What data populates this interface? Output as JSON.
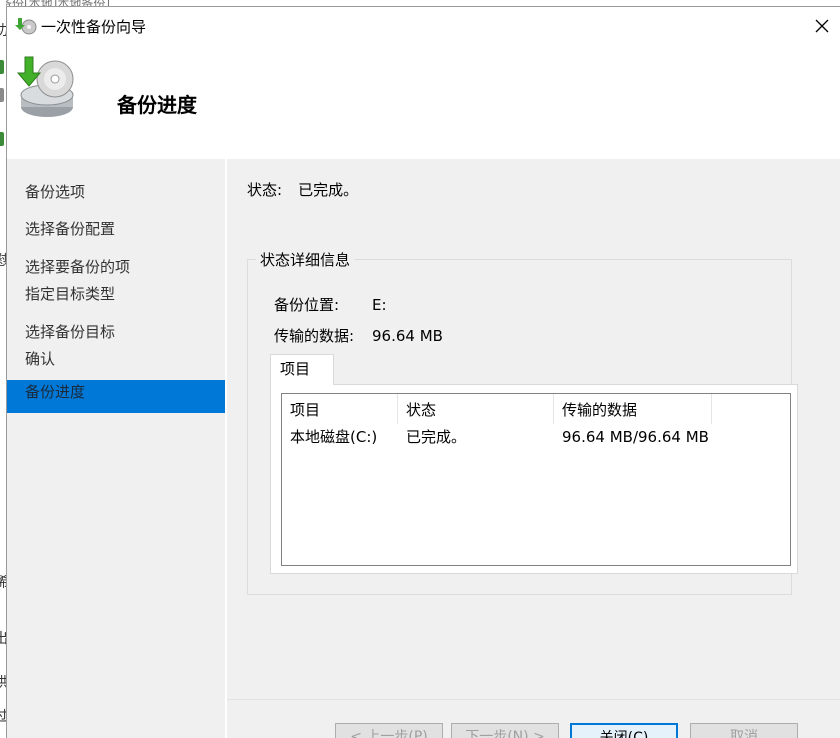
{
  "background": {
    "top_text": "备份[本地]本地备份]",
    "fragments": [
      "功",
      " ",
      "慰",
      "稀",
      "出",
      "烘",
      "过"
    ]
  },
  "dialog": {
    "title": "一次性备份向导",
    "header_title": "备份进度"
  },
  "nav": {
    "items": [
      {
        "label": "备份选项",
        "active": false
      },
      {
        "label": "选择备份配置",
        "active": false
      },
      {
        "label": "选择要备份的项",
        "active": false
      },
      {
        "label": "指定目标类型",
        "active": false
      },
      {
        "label": "选择备份目标",
        "active": false
      },
      {
        "label": "确认",
        "active": false
      },
      {
        "label": "备份进度",
        "active": true
      }
    ]
  },
  "status": {
    "label": "状态:",
    "value": "已完成。"
  },
  "details": {
    "group_title": "状态详细信息",
    "location_label": "备份位置:",
    "location_value": "E:",
    "transferred_label": "传输的数据:",
    "transferred_value": "96.64 MB",
    "tab_label": "项目",
    "columns": [
      "项目",
      "状态",
      "传输的数据"
    ],
    "rows": [
      {
        "item": "本地磁盘(C:)",
        "status": "已完成。",
        "transferred": "96.64 MB/96.64 MB"
      }
    ]
  },
  "buttons": {
    "prev": "< 上一步(P)",
    "next": "下一步(N) >",
    "close": "关闭(C)",
    "cancel": "取消"
  },
  "colors": {
    "accent": "#0078d7",
    "panel_bg": "#f0f0f0"
  }
}
